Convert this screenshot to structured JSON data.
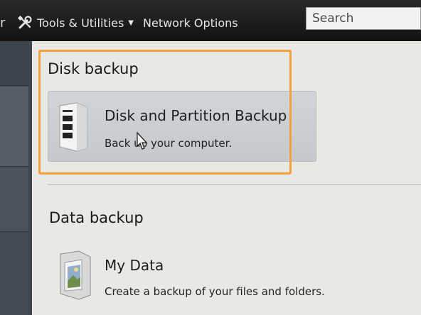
{
  "nav": {
    "edge_glyph": "r",
    "tools_label": "Tools & Utilities",
    "tools_icon": "tools-icon",
    "network_label": "Network Options",
    "search_placeholder": "Search"
  },
  "sections": {
    "disk_backup": {
      "title": "Disk backup",
      "tile": {
        "title": "Disk and Partition Backup",
        "description": "Back up your computer.",
        "icon": "hard-drive-icon"
      }
    },
    "data_backup": {
      "title": "Data backup",
      "item": {
        "title": "My Data",
        "description": "Create a backup of your files and folders.",
        "icon": "photo-folder-icon"
      }
    }
  },
  "colors": {
    "highlight": "#f5a03c",
    "topbar": "#1b1b1b",
    "sidebar": "#3f4650"
  }
}
